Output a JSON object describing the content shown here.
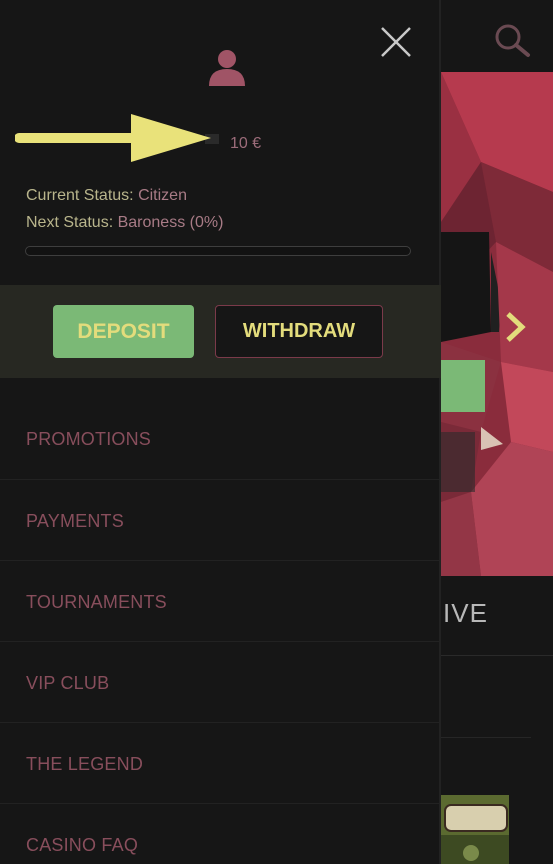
{
  "wallet": {
    "balance": "10 €"
  },
  "status": {
    "current_label": "Current Status:",
    "current_value": "Citizen",
    "next_label": "Next Status:",
    "next_value": "Baroness (0%)",
    "progress_fraction": 0.0
  },
  "actions": {
    "deposit_label": "DEPOSIT",
    "withdraw_label": "WITHDRAW"
  },
  "menu": {
    "items": [
      {
        "label": "PROMOTIONS"
      },
      {
        "label": "PAYMENTS"
      },
      {
        "label": "TOURNAMENTS"
      },
      {
        "label": "VIP CLUB"
      },
      {
        "label": "THE LEGEND"
      },
      {
        "label": "CASINO FAQ"
      }
    ]
  },
  "background": {
    "live_heading_fragment": "IVE"
  },
  "icons": {
    "close": "close-icon",
    "avatar": "user-icon",
    "search": "search-icon",
    "banner_next": "chevron-right-icon",
    "annotation": "arrow-right-icon"
  },
  "colors": {
    "accent_green": "#7bb976",
    "accent_yellow": "#e3dc7c",
    "menu_text": "#884e5c",
    "annotation_arrow": "#e9e27a"
  }
}
